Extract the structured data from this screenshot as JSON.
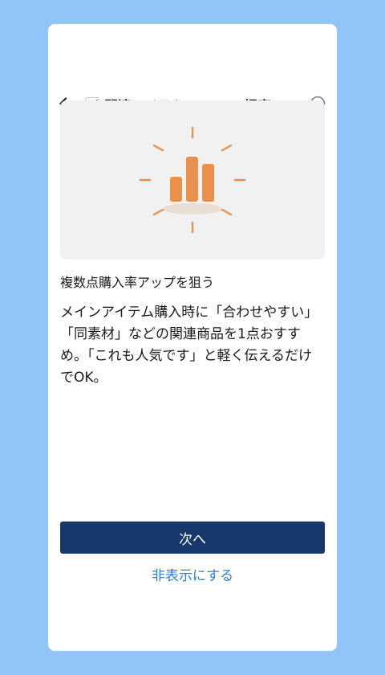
{
  "header": {
    "back_icon": "arrow-left-icon",
    "title_icon": "chart-increasing-icon",
    "title": "関連アイテムの\"ついで提案\"",
    "status_icon": "check-circle-icon"
  },
  "illustration": {
    "icon": "bar-chart-sparkle-icon",
    "accent_color": "#e8914f",
    "background_color": "#f1f1f1"
  },
  "content": {
    "subtitle": "複数点購入率アップを狙う",
    "body": "メインアイテム購入時に「合わせやすい」「同素材」などの関連商品を1点おすすめ。「これも人気です」と軽く伝えるだけでOK。"
  },
  "actions": {
    "next_label": "次へ",
    "hide_label": "非表示にする"
  },
  "colors": {
    "page_background": "#92c5f7",
    "primary_button": "#17386b",
    "link": "#2f7fcf"
  }
}
